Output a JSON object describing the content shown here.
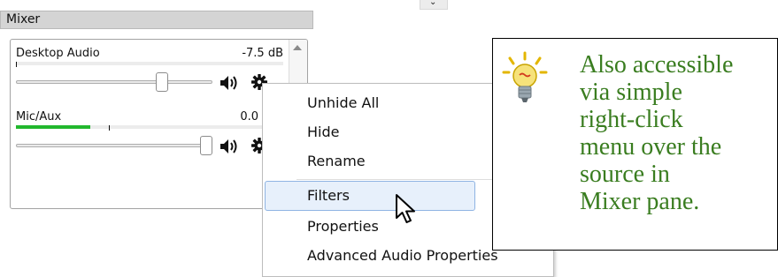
{
  "mixer": {
    "title": "Mixer",
    "channels": [
      {
        "name": "Desktop Audio",
        "level": "-7.5 dB",
        "meter_fill_fraction": 0.0,
        "volume_fraction": 0.82
      },
      {
        "name": "Mic/Aux",
        "level": "0.0",
        "meter_fill_fraction": 0.28,
        "volume_fraction": 1.0
      }
    ],
    "icons": {
      "speaker": "speaker-icon",
      "gear": "gear-icon",
      "scroll_up": "scroll-up-arrow-icon"
    }
  },
  "context_menu": {
    "items": [
      {
        "label": "Unhide All",
        "highlighted": false
      },
      {
        "label": "Hide",
        "highlighted": false
      },
      {
        "label": "Rename",
        "highlighted": false
      },
      {
        "label": "Filters",
        "highlighted": true
      },
      {
        "label": "Properties",
        "highlighted": false
      },
      {
        "label": "Advanced Audio Properties",
        "highlighted": false
      }
    ]
  },
  "callout": {
    "lines": [
      "Also accessible",
      "via simple",
      "right-click",
      "menu over the",
      "source in",
      "Mixer pane."
    ],
    "text_color": "#3a7d20",
    "icon": "lightbulb-icon"
  },
  "colors": {
    "meter_green": "#22b82e",
    "highlight_fill": "#e7f0fb",
    "highlight_border": "#8fb4e3"
  }
}
